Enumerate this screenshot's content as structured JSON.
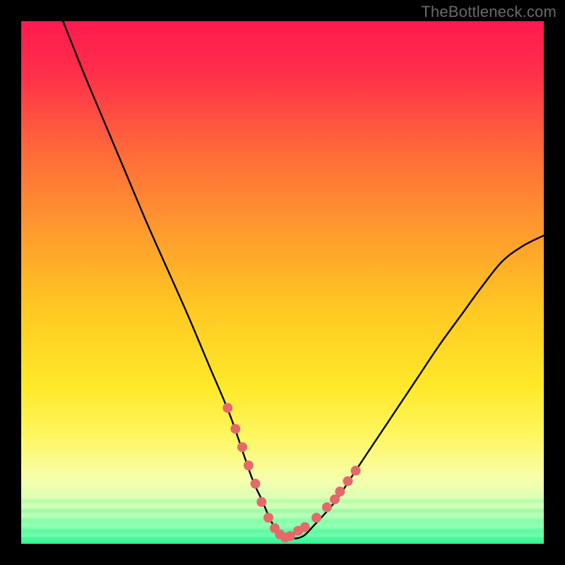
{
  "watermark": "TheBottleneck.com",
  "colors": {
    "frame_bg": "#000000",
    "curve_stroke": "#000000",
    "dot_fill": "#e46a6a",
    "gradient_stops": [
      {
        "offset": 0.0,
        "color": "#ff1a4f"
      },
      {
        "offset": 0.1,
        "color": "#ff2f4a"
      },
      {
        "offset": 0.25,
        "color": "#ff6a3a"
      },
      {
        "offset": 0.4,
        "color": "#ff9a2e"
      },
      {
        "offset": 0.55,
        "color": "#ffc822"
      },
      {
        "offset": 0.7,
        "color": "#ffe92a"
      },
      {
        "offset": 0.8,
        "color": "#fff765"
      },
      {
        "offset": 0.88,
        "color": "#f6ffb0"
      },
      {
        "offset": 0.93,
        "color": "#c9ffb0"
      },
      {
        "offset": 0.97,
        "color": "#7dffad"
      },
      {
        "offset": 1.0,
        "color": "#29f58e"
      }
    ],
    "stripe_colors": [
      "rgba(255,255,255,0.14)",
      "rgba(80,255,160,0.22)",
      "rgba(255,255,255,0.10)",
      "rgba(60,240,150,0.22)"
    ]
  },
  "chart_data": {
    "type": "line",
    "title": "",
    "xlabel": "",
    "ylabel": "",
    "xlim": [
      0,
      100
    ],
    "ylim": [
      0,
      100
    ],
    "notes": "V-shaped bottleneck curve. Y is bottleneck percentage (0 at bottom, ~100 at top). Minimum region ≈ x 45–55. Left branch starts near top-left, right branch exits near x=100 at ~59% height. Values estimated from pixels; no axis labels present.",
    "series": [
      {
        "name": "bottleneck-curve",
        "x": [
          8,
          12,
          16,
          20,
          24,
          28,
          32,
          36,
          40,
          44,
          46,
          48,
          50,
          52,
          54,
          56,
          60,
          64,
          68,
          72,
          76,
          80,
          84,
          88,
          92,
          96,
          100
        ],
        "y": [
          100,
          90,
          80.5,
          71,
          61.5,
          52.5,
          43.5,
          34,
          24.5,
          13,
          8.5,
          4,
          1.5,
          1,
          1.5,
          3.5,
          8,
          14,
          20,
          26,
          32,
          38,
          43.5,
          49,
          54,
          57,
          59
        ]
      }
    ],
    "marker_points": {
      "name": "highlighted-range-dots",
      "x": [
        39.5,
        41.0,
        42.3,
        43.5,
        44.8,
        46.0,
        47.3,
        48.5,
        49.5,
        50.5,
        51.5,
        53.0,
        54.3,
        56.5,
        58.5,
        60.0,
        61.0,
        62.5,
        64.0
      ],
      "y": [
        26.0,
        22.0,
        18.5,
        15.0,
        11.5,
        8.0,
        5.0,
        3.0,
        1.8,
        1.2,
        1.5,
        2.5,
        3.2,
        5.0,
        7.0,
        8.5,
        10.0,
        12.0,
        14.0
      ]
    }
  }
}
